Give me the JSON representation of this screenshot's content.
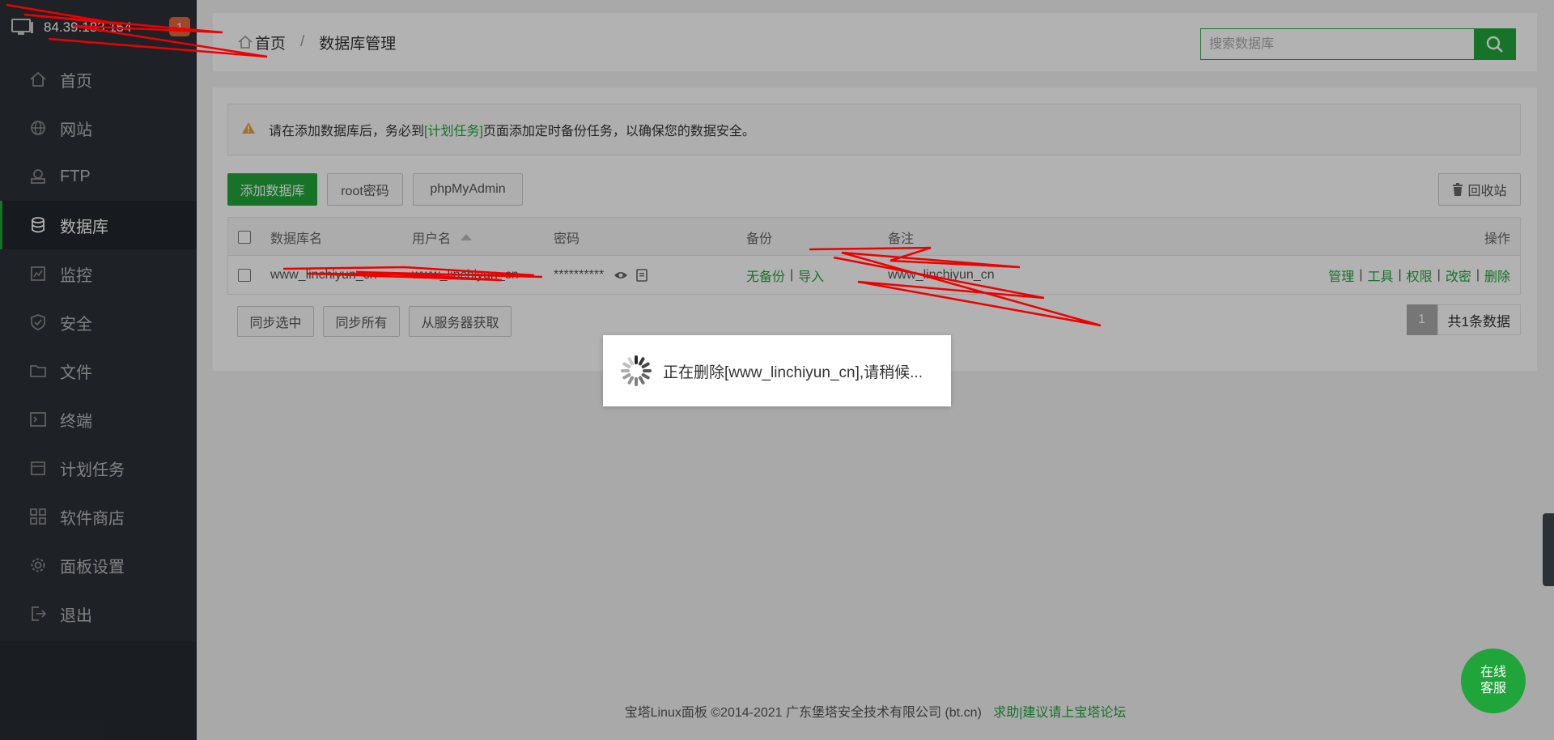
{
  "sidebar": {
    "ip": "84.39.183.154",
    "badge": "1",
    "items": [
      {
        "label": "首页",
        "icon": "home-icon"
      },
      {
        "label": "网站",
        "icon": "globe-icon"
      },
      {
        "label": "FTP",
        "icon": "ftp-icon"
      },
      {
        "label": "数据库",
        "icon": "database-icon",
        "active": true
      },
      {
        "label": "监控",
        "icon": "monitor-icon"
      },
      {
        "label": "安全",
        "icon": "shield-icon"
      },
      {
        "label": "文件",
        "icon": "folder-icon"
      },
      {
        "label": "终端",
        "icon": "terminal-icon"
      },
      {
        "label": "计划任务",
        "icon": "calendar-icon"
      },
      {
        "label": "软件商店",
        "icon": "apps-icon"
      },
      {
        "label": "面板设置",
        "icon": "gear-icon"
      },
      {
        "label": "退出",
        "icon": "logout-icon"
      }
    ]
  },
  "header": {
    "breadcrumb_home": "首页",
    "breadcrumb_sep": "/",
    "breadcrumb_current": "数据库管理",
    "search_placeholder": "搜索数据库"
  },
  "notice": {
    "before": "请在添加数据库后，务必到",
    "link": "[计划任务]",
    "after": "页面添加定时备份任务，以确保您的数据安全。"
  },
  "toolbar": {
    "add": "添加数据库",
    "root": "root密码",
    "phpmyadmin": "phpMyAdmin",
    "recycle": "回收站"
  },
  "table": {
    "headers": {
      "name": "数据库名",
      "user": "用户名",
      "password": "密码",
      "backup": "备份",
      "note": "备注",
      "ops": "操作"
    },
    "rows": [
      {
        "name": "www_linchiyun_cn",
        "user": "www_linchiyun_cn",
        "password": "**********",
        "backup_none": "无备份",
        "backup_sep": "|",
        "import": "导入",
        "note": "www_linchiyun_cn",
        "ops": [
          "管理",
          "工具",
          "权限",
          "改密",
          "删除"
        ]
      }
    ]
  },
  "bottom": {
    "sync_selected": "同步选中",
    "sync_all": "同步所有",
    "fetch": "从服务器获取",
    "page": "1",
    "total": "共1条数据"
  },
  "loading_text": "正在删除[www_linchiyun_cn],请稍候...",
  "footer": {
    "copyright": "宝塔Linux面板 ©2014-2021 广东堡塔安全技术有限公司 (bt.cn)",
    "forum": "求助|建议请上宝塔论坛"
  },
  "chat": {
    "line1": "在线",
    "line2": "客服"
  },
  "colors": {
    "brand": "#20a53a",
    "sidebar": "#2c3138",
    "badge": "#e2693b"
  }
}
